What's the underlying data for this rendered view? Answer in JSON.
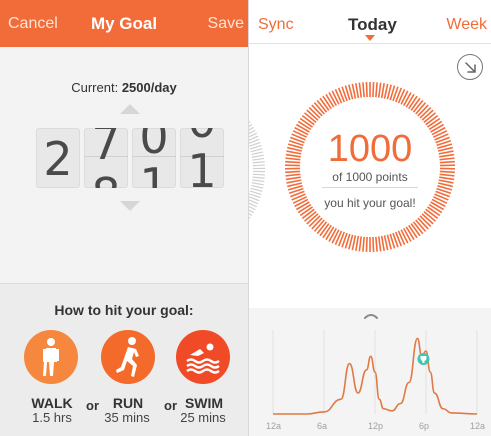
{
  "left_panel": {
    "header": {
      "cancel": "Cancel",
      "title": "My Goal",
      "save": "Save"
    },
    "current_prefix": "Current: ",
    "current_value": "2500/day",
    "picker": {
      "d0": "2",
      "d1a": "7",
      "d1b": "8",
      "d2a": "0",
      "d2b": "1",
      "d3a": "0",
      "d3b": "1"
    },
    "howto_title": "How to hit your goal:",
    "activities": [
      {
        "name": "WALK",
        "value": "1.5 hrs",
        "icon": "walk-icon",
        "color": "#f5883e"
      },
      {
        "name": "RUN",
        "value": "35 mins",
        "icon": "run-icon",
        "color": "#f36a2b"
      },
      {
        "name": "SWIM",
        "value": "25 mins",
        "icon": "swim-icon",
        "color": "#f14a26"
      }
    ],
    "or_label": "or"
  },
  "right_panel": {
    "header": {
      "sync": "Sync",
      "today": "Today",
      "week": "Week"
    },
    "points_value": "1000",
    "points_sub": "of 1000 points",
    "hit_message": "you hit your goal!",
    "goal_progress": 1.0,
    "chart_data": {
      "type": "line",
      "x_ticks": [
        "12a",
        "6a",
        "12p",
        "6p",
        "12a"
      ],
      "x_hours": [
        0,
        4,
        6,
        8,
        9,
        10,
        11,
        11.5,
        12,
        12.5,
        13,
        14,
        15,
        16,
        17,
        17.5,
        18,
        18.5,
        19,
        20,
        21,
        24
      ],
      "y": [
        0,
        0,
        2,
        14,
        48,
        20,
        42,
        55,
        40,
        14,
        5,
        3,
        10,
        30,
        72,
        55,
        60,
        40,
        20,
        5,
        1,
        0
      ],
      "marker_x": 17.7,
      "marker_icon": "trophy-icon"
    }
  },
  "colors": {
    "accent": "#f26c3a",
    "header_bg": "#f26c3a",
    "chart_line": "#e07a45",
    "marker": "#3dc7b3"
  }
}
